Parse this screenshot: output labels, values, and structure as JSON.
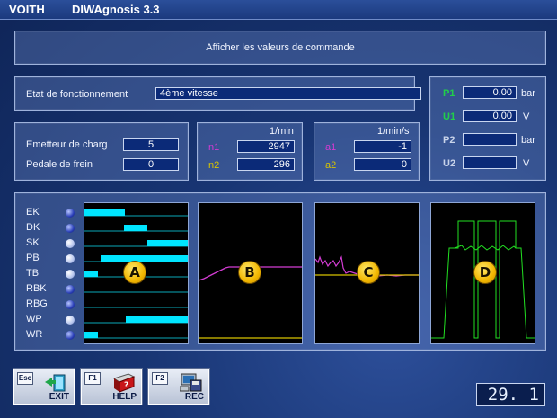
{
  "window": {
    "brand": "VOITH",
    "app_name": "DIWAgnosis 3.3"
  },
  "header": {
    "title": "Afficher les valeurs de commande"
  },
  "status": {
    "label": "Etat de fonctionnement",
    "value": "4ème vitesse"
  },
  "pressure": {
    "p1_label": "P1",
    "p1_value": "0.00",
    "p1_unit": "bar",
    "u1_label": "U1",
    "u1_value": "0.00",
    "u1_unit": "V",
    "p2_label": "P2",
    "p2_value": "",
    "p2_unit": "bar",
    "u2_label": "U2",
    "u2_value": "",
    "u2_unit": "V"
  },
  "inputs": {
    "emetteur_label": "Emetteur de charg",
    "emetteur_value": "5",
    "pedale_label": "Pedale de frein",
    "pedale_value": "0"
  },
  "speeds": {
    "unit": "1/min",
    "n1_label": "n1",
    "n1_value": "2947",
    "n2_label": "n2",
    "n2_value": "296"
  },
  "accel": {
    "unit": "1/min/s",
    "a1_label": "a1",
    "a1_value": "-1",
    "a2_label": "a2",
    "a2_value": "0"
  },
  "signals": [
    {
      "label": "EK",
      "lit": false
    },
    {
      "label": "DK",
      "lit": false
    },
    {
      "label": "SK",
      "lit": true
    },
    {
      "label": "PB",
      "lit": true
    },
    {
      "label": "TB",
      "lit": true
    },
    {
      "label": "RBK",
      "lit": false
    },
    {
      "label": "RBG",
      "lit": false
    },
    {
      "label": "WP",
      "lit": true
    },
    {
      "label": "WR",
      "lit": false
    }
  ],
  "graphs": {
    "a_label": "A",
    "b_label": "B",
    "c_label": "C",
    "d_label": "D"
  },
  "colors": {
    "cyan_bar": "#00e5ff",
    "magenta_trace": "#d23cd2",
    "yellow_trace": "#d8c400",
    "green_trace": "#22e022"
  },
  "buttons": {
    "exit_key": "Esc",
    "exit_label": "EXIT",
    "help_key": "F1",
    "help_label": "HELP",
    "rec_key": "F2",
    "rec_label": "REC"
  },
  "display": {
    "value": "29. 1"
  }
}
